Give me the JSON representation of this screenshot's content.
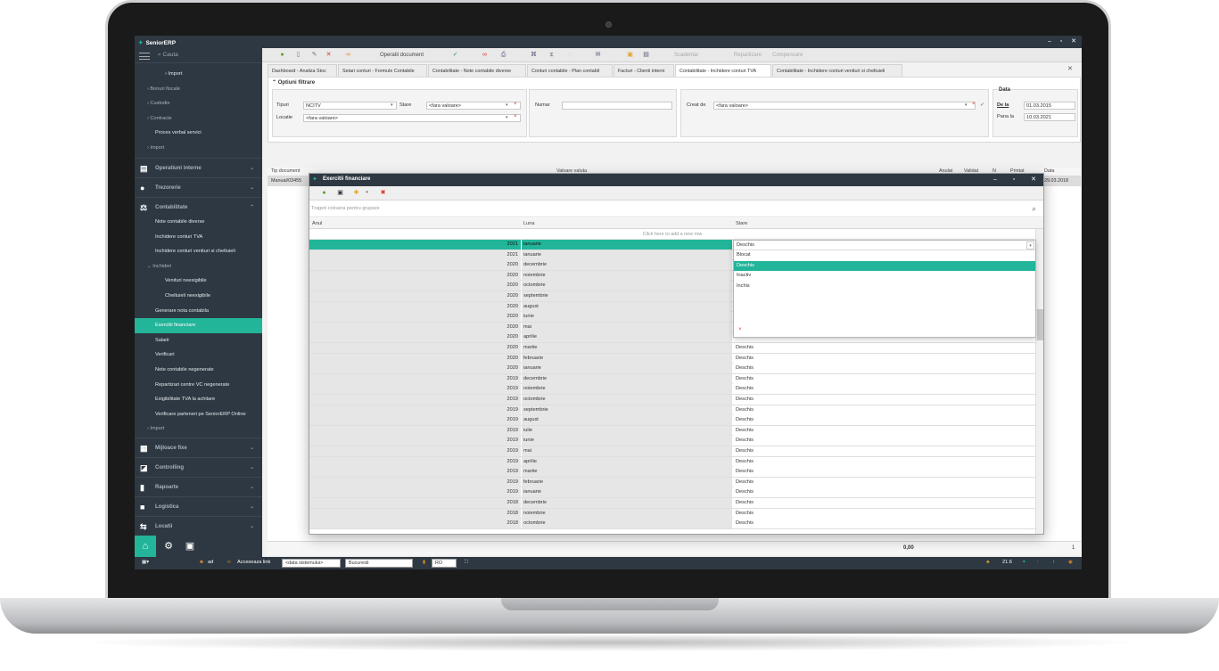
{
  "app": {
    "logo": "SeniorERP"
  },
  "sidebar": {
    "search_placeholder": "Cauta",
    "items": [
      {
        "label": "Import",
        "level": "lvl3"
      },
      {
        "label": "Bonuri fiscale",
        "level": "grp"
      },
      {
        "label": "Custodie",
        "level": "grp"
      },
      {
        "label": "Contracte",
        "level": "grp"
      },
      {
        "label": "Proces verbal servici",
        "level": "lvl2"
      },
      {
        "label": "Import",
        "level": "grp"
      }
    ],
    "categories": {
      "operatiuni": "Operatiuni interne",
      "trezorerie": "Trezorerie",
      "contabilitate": "Contabilitate",
      "mijloace": "Mijloace fixe",
      "controlling": "Controlling",
      "rapoarte": "Rapoarte",
      "logistica": "Logistica",
      "locatii": "Locatii"
    },
    "contabilitate_items": [
      {
        "label": "Note contabile diverse",
        "level": "lvl2"
      },
      {
        "label": "Inchidere conturi TVA",
        "level": "lvl2"
      },
      {
        "label": "Inchidere conturi venituri si cheltuieli",
        "level": "lvl2"
      },
      {
        "label": "Inchideri",
        "level": "grp"
      },
      {
        "label": "Venituri neexigibile",
        "level": "lvl3"
      },
      {
        "label": "Cheltuieli neexigibile",
        "level": "lvl3"
      },
      {
        "label": "Generare nota contabila",
        "level": "lvl2"
      },
      {
        "label": "Exercitii financiare",
        "level": "lvl2",
        "active": true
      },
      {
        "label": "Salarii",
        "level": "lvl2"
      },
      {
        "label": "Verificari",
        "level": "lvl2"
      },
      {
        "label": "Note contabile negenerate",
        "level": "lvl2"
      },
      {
        "label": "Repartizari centre VC negenerate",
        "level": "lvl2"
      },
      {
        "label": "Exigibilitate TVA la achitare",
        "level": "lvl2"
      },
      {
        "label": "Verificare parteneri pe SeniorERP Online",
        "level": "lvl2"
      },
      {
        "label": "Import",
        "level": "grp"
      }
    ]
  },
  "toolbar": {
    "operatii": "Operatii document",
    "scadentar": "Scadentar",
    "repartizare": "Repartizare",
    "compensare": "Compensare"
  },
  "tabs": [
    {
      "label": "Dashboard - Analiza Stoc"
    },
    {
      "label": "Setari conturi - Formule Contabile"
    },
    {
      "label": "Contabilitate - Note contabile diverse"
    },
    {
      "label": "Conturi contabile - Plan contabil"
    },
    {
      "label": "Facturi - Clienti interni"
    },
    {
      "label": "Contabilitate - Inchidere conturi TVA",
      "active": true
    },
    {
      "label": "Contabilitate - Inchidere conturi venituri si cheltuieli"
    }
  ],
  "filters": {
    "title": "Optiuni filtrare",
    "tipuri_label": "Tipuri",
    "tipuri_value": "NCITV",
    "stare_label": "Stare",
    "stare_value": "<fara valoare>",
    "locatie_label": "Locatie",
    "locatie_value": "<fara valoare>",
    "numar_label": "Numar",
    "creat_label": "Creat de",
    "creat_value": "<fara valoare>",
    "data_title": "Data",
    "de_la_label": "De la",
    "de_la_value": "01.03.2015",
    "pana_label": "Pana la",
    "pana_value": "10.03.2021"
  },
  "grid": {
    "headers": {
      "tip": "Tip document",
      "valoare": "Valoare valuta",
      "anulat": "Anulat",
      "validat": "Validat",
      "n": "N",
      "printat": "Printat",
      "data": "Data"
    },
    "row": {
      "tip": "Manual/03455",
      "data": "29.03.2018"
    },
    "footer_total": "0,00",
    "footer_count": "1"
  },
  "dialog": {
    "title": "Exercitii financiare",
    "group_hint": "Trageti coloana pentru grupare",
    "columns": {
      "anul": "Anul",
      "luna": "Luna",
      "stare": "Stare"
    },
    "add_row": "Click here to add a new row",
    "rows": [
      [
        "2021",
        "ianuarie",
        ""
      ],
      [
        "2021",
        "ianuarie",
        ""
      ],
      [
        "2020",
        "decembrie",
        ""
      ],
      [
        "2020",
        "noiembrie",
        ""
      ],
      [
        "2020",
        "octombrie",
        ""
      ],
      [
        "2020",
        "septembrie",
        ""
      ],
      [
        "2020",
        "august",
        ""
      ],
      [
        "2020",
        "iunie",
        ""
      ],
      [
        "2020",
        "mai",
        ""
      ],
      [
        "2020",
        "aprilie",
        "Deschis"
      ],
      [
        "2020",
        "martie",
        "Deschis"
      ],
      [
        "2020",
        "februarie",
        "Deschis"
      ],
      [
        "2020",
        "ianuarie",
        "Deschis"
      ],
      [
        "2019",
        "decembrie",
        "Deschis"
      ],
      [
        "2019",
        "noiembrie",
        "Deschis"
      ],
      [
        "2019",
        "octombrie",
        "Deschis"
      ],
      [
        "2019",
        "septembrie",
        "Deschis"
      ],
      [
        "2019",
        "august",
        "Deschis"
      ],
      [
        "2019",
        "iulie",
        "Deschis"
      ],
      [
        "2019",
        "iunie",
        "Deschis"
      ],
      [
        "2019",
        "mai",
        "Deschis"
      ],
      [
        "2019",
        "aprilie",
        "Deschis"
      ],
      [
        "2019",
        "martie",
        "Deschis"
      ],
      [
        "2019",
        "februarie",
        "Deschis"
      ],
      [
        "2019",
        "ianuarie",
        "Deschis"
      ],
      [
        "2018",
        "decembrie",
        "Deschis"
      ],
      [
        "2018",
        "noiembrie",
        "Deschis"
      ],
      [
        "2018",
        "octombrie",
        "Deschis"
      ]
    ],
    "dropdown": {
      "current": "Deschis",
      "options": [
        "Blocat",
        "Deschis",
        "Inactiv",
        "Inchis"
      ],
      "highlighted": "Deschis"
    }
  },
  "statusbar": {
    "user": "ad",
    "link": "Acceseaza link",
    "date_field": "<data sistemului>",
    "city": "Bucuresti",
    "lang": "RO",
    "temp": "21.6"
  },
  "colors": {
    "accent": "#22b59a",
    "dark": "#2e3842"
  }
}
